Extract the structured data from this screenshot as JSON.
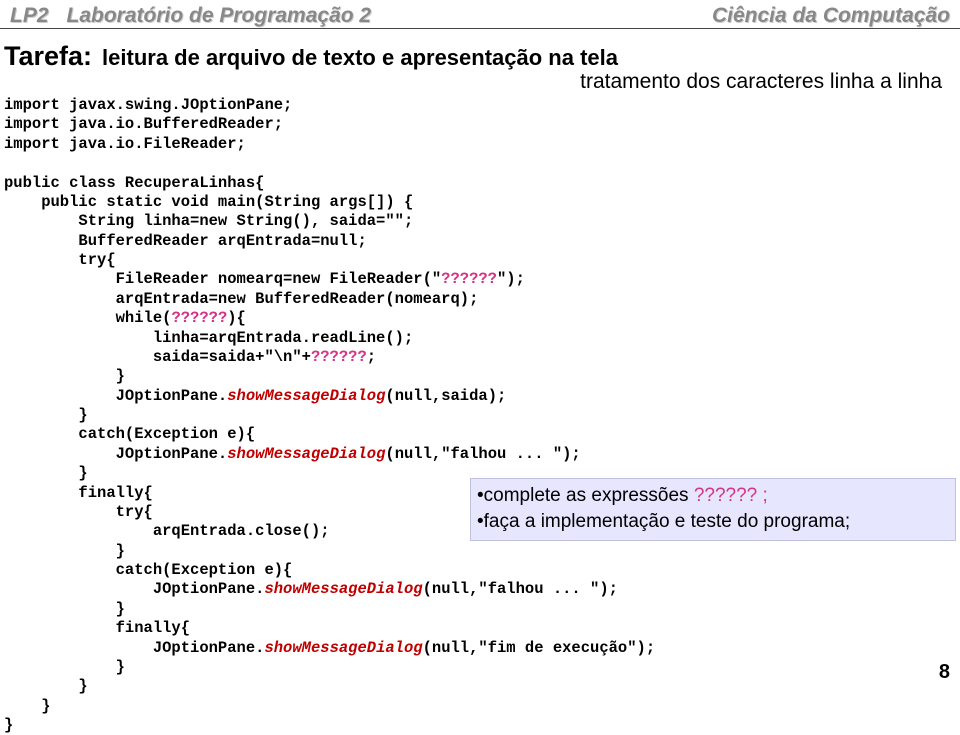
{
  "header": {
    "abbr": "LP2",
    "course": "Laboratório de Programação 2",
    "dept": "Ciência da Computação"
  },
  "title": {
    "main": "Tarefa:",
    "sub": "leitura de arquivo de texto e apresentação na tela"
  },
  "subtitle": "tratamento dos caracteres linha a linha",
  "code": {
    "l01": "import javax.swing.JOptionPane;",
    "l02": "import java.io.BufferedReader;",
    "l03": "import java.io.FileReader;",
    "l04": "",
    "l05": "public class RecuperaLinhas{",
    "l06": "    public static void main(String args[]) {",
    "l07": "        String linha=new String(), saida=\"\";",
    "l08": "        BufferedReader arqEntrada=null;",
    "l09": "        try{",
    "l10a": "            FileReader nomearq=new FileReader(\"",
    "l10b": "??????",
    "l10c": "\");",
    "l11": "            arqEntrada=new BufferedReader(nomearq);",
    "l12a": "            while(",
    "l12b": "??????",
    "l12c": "){",
    "l13": "                linha=arqEntrada.readLine();",
    "l14a": "                saida=saida+\"\\n\"+",
    "l14b": "??????",
    "l14c": ";",
    "l15": "            }",
    "l16a": "            JOptionPane.",
    "l16b": "showMessageDialog",
    "l16c": "(null,saida);",
    "l17": "        }",
    "l18": "        catch(Exception e){",
    "l19a": "            JOptionPane.",
    "l19b": "showMessageDialog",
    "l19c": "(null,\"falhou ... \");",
    "l20": "        }",
    "l21": "        finally{",
    "l22": "            try{",
    "l23": "                arqEntrada.close();",
    "l24": "            }",
    "l25": "            catch(Exception e){",
    "l26a": "                JOptionPane.",
    "l26b": "showMessageDialog",
    "l26c": "(null,\"falhou ... \");",
    "l27": "            }",
    "l28": "            finally{",
    "l29a": "                JOptionPane.",
    "l29b": "showMessageDialog",
    "l29c": "(null,\"fim de execução\");",
    "l30": "            }",
    "l31": "        }",
    "l32": "    }",
    "l33": "}"
  },
  "callout": {
    "line1a": "•complete as expressões",
    "line1b": "?????? ;",
    "line2": "•faça a implementação e teste do programa;"
  },
  "pagenum": "8"
}
